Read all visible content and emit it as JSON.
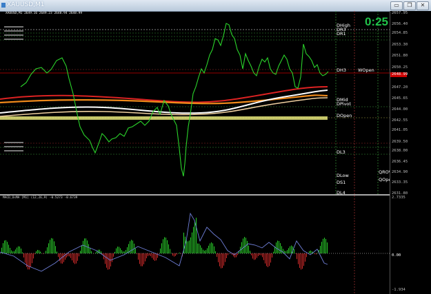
{
  "window": {
    "title": "XAUUSD,M1"
  },
  "window_buttons": [
    "▭",
    "❐",
    "✕"
  ],
  "main_chart": {
    "symbol_info": "XAUUSD,M1 2649.16 2649.23 2648.94 2648.99",
    "countdown": "0:25",
    "current_price": "2648.99",
    "y_labels": [
      "2657.95",
      "2656.40",
      "2654.85",
      "2653.30",
      "2651.80",
      "2650.25",
      "2647.20",
      "2645.65",
      "2644.00",
      "2642.55",
      "2641.05",
      "2639.50",
      "2638.00",
      "2636.45",
      "2634.90",
      "2633.35",
      "2631.80"
    ],
    "level_labels": [
      {
        "text": "DHigh",
        "color": "#ffffff"
      },
      {
        "text": "DR3",
        "color": "#ffffff"
      },
      {
        "text": "DR1",
        "color": "#ffffff"
      },
      {
        "text": "DH3",
        "color": "#ffffff"
      },
      {
        "text": "WOpen",
        "color": "#ffffff"
      },
      {
        "text": "DMid",
        "color": "#ffffff"
      },
      {
        "text": "DPivot",
        "color": "#ffffff"
      },
      {
        "text": "DOpen",
        "color": "#ffffff"
      },
      {
        "text": "DL3",
        "color": "#ffffff"
      },
      {
        "text": "QROVR",
        "color": "#ffffff"
      },
      {
        "text": "DLow",
        "color": "#ffffff"
      },
      {
        "text": "QOpen",
        "color": "#ffffff"
      },
      {
        "text": "DS1",
        "color": "#ffffff"
      },
      {
        "text": "DL4",
        "color": "#ffffff"
      }
    ]
  },
  "macd": {
    "label": "MACD_OsMA [M1] (12,26,9) -0.5273 -0.6739",
    "y_top": "2.7335",
    "y_zero": "0.00",
    "y_bottom": "-1.934"
  }
}
